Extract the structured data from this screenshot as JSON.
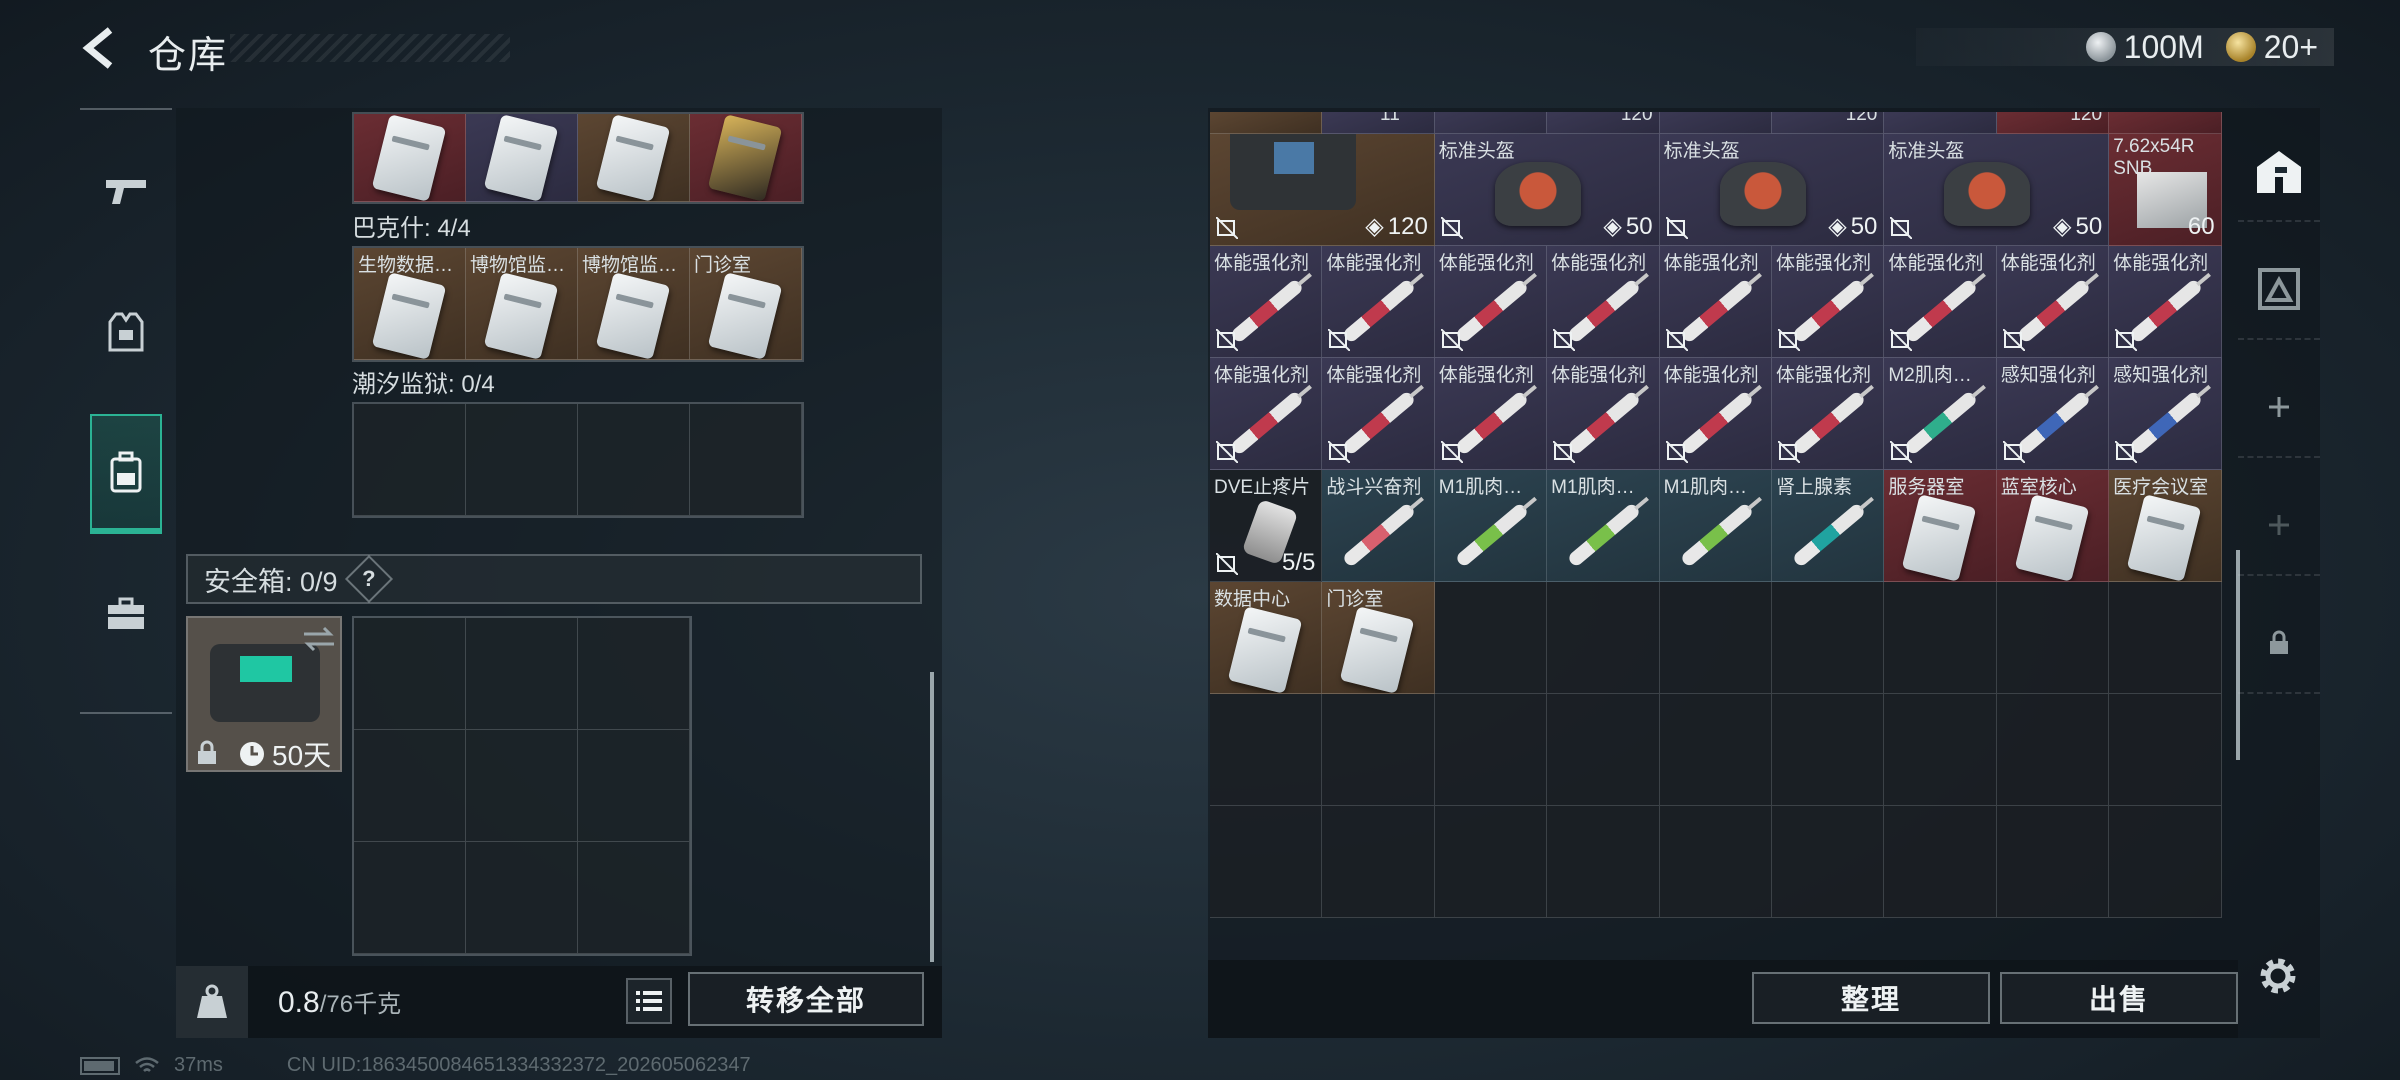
{
  "header": {
    "title": "仓库"
  },
  "currency": {
    "silver": "100M",
    "gold": "20+"
  },
  "left_tabs": [
    {
      "name": "gun-icon"
    },
    {
      "name": "vest-icon"
    },
    {
      "name": "backpack-icon"
    },
    {
      "name": "briefcase-icon"
    }
  ],
  "pouch": {
    "top_row": [
      {
        "label": "",
        "bg": "red",
        "item": "card"
      },
      {
        "label": "",
        "bg": "purple",
        "item": "card"
      },
      {
        "label": "",
        "bg": "brown",
        "item": "card"
      },
      {
        "label": "",
        "bg": "red",
        "item": "gold-card"
      }
    ],
    "section2": {
      "title": "巴克什: 4/4",
      "cells": [
        {
          "label": "生物数据…"
        },
        {
          "label": "博物馆监…"
        },
        {
          "label": "博物馆监…"
        },
        {
          "label": "门诊室"
        }
      ]
    },
    "section3": {
      "title": "潮汐监狱: 0/4"
    }
  },
  "safe_box": {
    "title": "安全箱: 0/9",
    "help": "?",
    "duration": "50天"
  },
  "weight": {
    "current": "0.8",
    "max": "/76千克"
  },
  "buttons": {
    "transfer_all": "转移全部",
    "organize": "整理",
    "sell": "出售"
  },
  "inventory": {
    "top_partial_counts": [
      "11",
      "120",
      "120",
      "120"
    ],
    "row1": [
      {
        "label": "",
        "bg": "brown",
        "item": "rig",
        "count": "120",
        "badge": "shield"
      },
      {
        "label": "标准头盔",
        "bg": "purple",
        "item": "helmet",
        "count": "50",
        "badge": "shield"
      },
      {
        "label": "标准头盔",
        "bg": "purple",
        "item": "helmet",
        "count": "50",
        "badge": "shield"
      },
      {
        "label": "标准头盔",
        "bg": "purple",
        "item": "helmet",
        "count": "50",
        "badge": "shield"
      },
      {
        "label": "7.62x54R SNB",
        "bg": "red",
        "item": "ammo",
        "count": "60"
      }
    ],
    "row2": [
      {
        "label": "体能强化剂",
        "color": "red"
      },
      {
        "label": "体能强化剂",
        "color": "red"
      },
      {
        "label": "体能强化剂",
        "color": "red"
      },
      {
        "label": "体能强化剂",
        "color": "red"
      },
      {
        "label": "体能强化剂",
        "color": "red"
      },
      {
        "label": "体能强化剂",
        "color": "red"
      },
      {
        "label": "体能强化剂",
        "color": "red"
      },
      {
        "label": "体能强化剂",
        "color": "red"
      },
      {
        "label": "体能强化剂",
        "color": "red"
      }
    ],
    "row3": [
      {
        "label": "体能强化剂",
        "color": "red"
      },
      {
        "label": "体能强化剂",
        "color": "red"
      },
      {
        "label": "体能强化剂",
        "color": "red"
      },
      {
        "label": "体能强化剂",
        "color": "red"
      },
      {
        "label": "体能强化剂",
        "color": "red"
      },
      {
        "label": "体能强化剂",
        "color": "red"
      },
      {
        "label": "M2肌肉…",
        "color": "teal"
      },
      {
        "label": "感知强化剂",
        "color": "blue"
      },
      {
        "label": "感知强化剂",
        "color": "blue"
      }
    ],
    "row4": [
      {
        "label": "DVE止疼片",
        "bg": "dark",
        "item": "pills",
        "count": "5/5"
      },
      {
        "label": "战斗兴奋剂",
        "bg": "blue",
        "item": "syringe",
        "color": "pink"
      },
      {
        "label": "M1肌肉…",
        "bg": "blue",
        "item": "syringe",
        "color": "green"
      },
      {
        "label": "M1肌肉…",
        "bg": "blue",
        "item": "syringe",
        "color": "green"
      },
      {
        "label": "M1肌肉…",
        "bg": "blue",
        "item": "syringe",
        "color": "green"
      },
      {
        "label": "肾上腺素",
        "bg": "blue",
        "item": "syringe",
        "color": "cyan"
      },
      {
        "label": "服务器室",
        "bg": "red",
        "item": "card"
      },
      {
        "label": "蓝室核心",
        "bg": "red",
        "item": "card"
      },
      {
        "label": "医疗会议室",
        "bg": "brown",
        "item": "card"
      }
    ],
    "row5": [
      {
        "label": "数据中心",
        "bg": "brown",
        "item": "card"
      },
      {
        "label": "门诊室",
        "bg": "brown",
        "item": "card"
      }
    ]
  },
  "status": {
    "ping": "37ms",
    "uid": "CN UID:1863450084651334332372_202605062347"
  }
}
